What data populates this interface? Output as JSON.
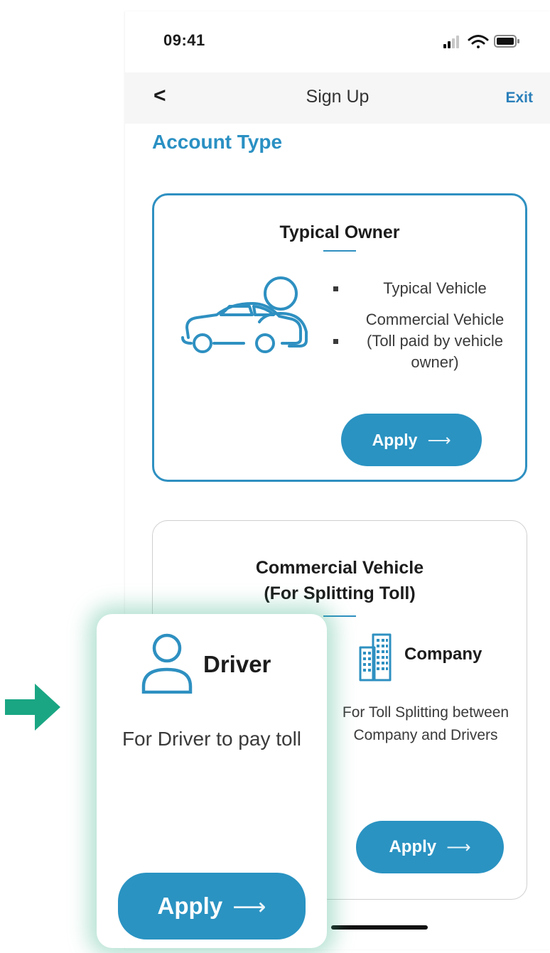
{
  "status_bar": {
    "time": "09:41"
  },
  "navbar": {
    "back_label": "<",
    "title": "Sign Up",
    "exit_label": "Exit"
  },
  "section_title": "Account Type",
  "typical_owner": {
    "title": "Typical Owner",
    "bullets": [
      "Typical Vehicle",
      "Commercial Vehicle (Toll paid by vehicle owner)"
    ],
    "apply_label": "Apply",
    "arrow": "⟶"
  },
  "commercial": {
    "title_line1": "Commercial Vehicle",
    "title_line2": "(For Splitting Toll)",
    "company": {
      "label": "Company",
      "description": "For Toll Splitting between Company and Drivers",
      "apply_label": "Apply",
      "arrow": "⟶"
    },
    "driver": {
      "label": "Driver",
      "description": "For Driver to pay toll",
      "apply_label": "Apply",
      "arrow": "⟶"
    }
  },
  "colors": {
    "accent": "#2a93c2",
    "highlight_glow": "#40b48c",
    "pointer_arrow": "#1aa683"
  }
}
